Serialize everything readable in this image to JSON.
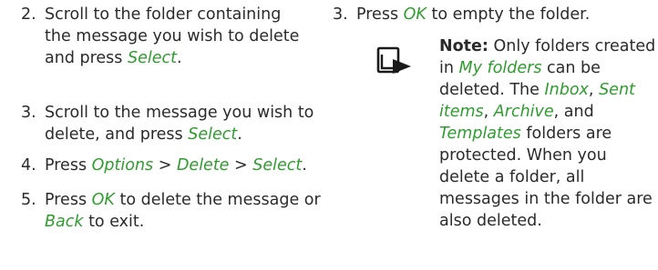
{
  "left_steps": [
    {
      "number": "2.",
      "lines": [
        [
          {
            "t": "Scroll to the folder containing",
            "g": false
          }
        ],
        [
          {
            "t": "the message you wish to delete",
            "g": false
          }
        ],
        [
          {
            "t": "and press ",
            "g": false
          },
          {
            "t": "Select",
            "g": true
          },
          {
            "t": ".",
            "g": false
          }
        ]
      ]
    },
    {
      "number": "3.",
      "lines": [
        [
          {
            "t": "Scroll to the message you wish to",
            "g": false
          }
        ],
        [
          {
            "t": "delete, and press ",
            "g": false
          },
          {
            "t": "Select",
            "g": true
          },
          {
            "t": ".",
            "g": false
          }
        ]
      ]
    },
    {
      "number": "4.",
      "lines": [
        [
          {
            "t": "Press ",
            "g": false
          },
          {
            "t": "Options",
            "g": true
          },
          {
            "t": " > ",
            "g": false
          },
          {
            "t": "Delete",
            "g": true
          },
          {
            "t": " > ",
            "g": false
          },
          {
            "t": "Select",
            "g": true
          },
          {
            "t": ".",
            "g": false
          }
        ]
      ]
    },
    {
      "number": "5.",
      "lines": [
        [
          {
            "t": "Press ",
            "g": false
          },
          {
            "t": "OK",
            "g": true
          },
          {
            "t": " to delete the message or",
            "g": false
          }
        ],
        [
          {
            "t": "Back",
            "g": true
          },
          {
            "t": " to exit.",
            "g": false
          }
        ]
      ]
    }
  ],
  "right_step": {
    "number": "3.",
    "lines": [
      [
        {
          "t": "Press ",
          "g": false
        },
        {
          "t": "OK",
          "g": true
        },
        {
          "t": " to empty the folder.",
          "g": false
        }
      ]
    ]
  },
  "note": {
    "icon": "note-icon",
    "label": "Note:",
    "lines": [
      [
        {
          "t": "Note:",
          "b": true
        },
        {
          "t": " Only folders created",
          "g": false
        }
      ],
      [
        {
          "t": "in ",
          "g": false
        },
        {
          "t": "My folders",
          "g": true
        },
        {
          "t": " can be",
          "g": false
        }
      ],
      [
        {
          "t": "deleted. The ",
          "g": false
        },
        {
          "t": "Inbox",
          "g": true
        },
        {
          "t": ", ",
          "g": false
        },
        {
          "t": "Sent",
          "g": true
        }
      ],
      [
        {
          "t": "items",
          "g": true
        },
        {
          "t": ", ",
          "g": false
        },
        {
          "t": "Archive",
          "g": true
        },
        {
          "t": ", and",
          "g": false
        }
      ],
      [
        {
          "t": "Templates",
          "g": true
        },
        {
          "t": " folders are",
          "g": false
        }
      ],
      [
        {
          "t": "protected. When you",
          "g": false
        }
      ],
      [
        {
          "t": "delete a folder, all",
          "g": false
        }
      ],
      [
        {
          "t": "messages in the folder are",
          "g": false
        }
      ],
      [
        {
          "t": "also deleted.",
          "g": false
        }
      ]
    ]
  },
  "colors": {
    "link": "#2e9c2e",
    "text": "#2b2b2b"
  }
}
